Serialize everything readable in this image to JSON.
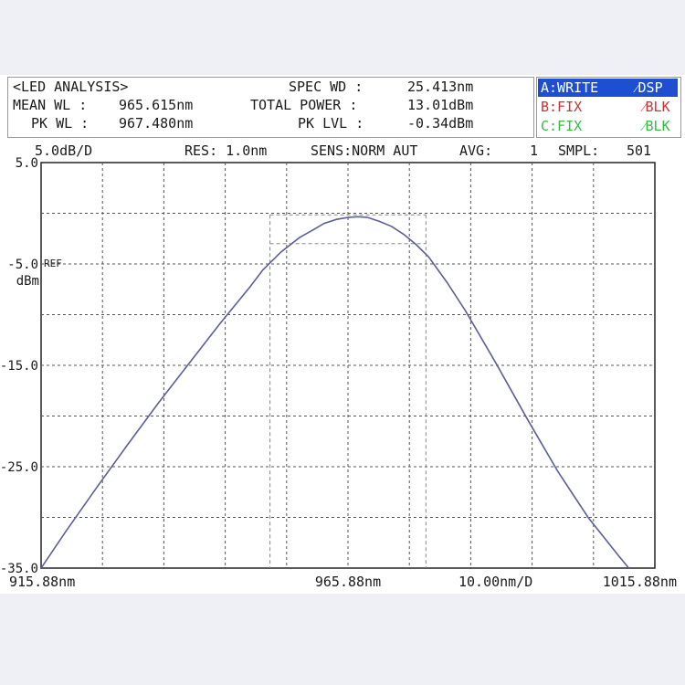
{
  "header": {
    "title": "<LED ANALYSIS>",
    "mean_wl_label": "MEAN WL :",
    "mean_wl_value": "965.615nm",
    "pk_wl_label": "PK WL :",
    "pk_wl_value": "967.480nm",
    "spec_wd_label": "SPEC WD :",
    "spec_wd_value": "25.413nm",
    "total_power_label": "TOTAL POWER :",
    "total_power_value": "13.01dBm",
    "pk_lvl_label": "PK LVL :",
    "pk_lvl_value": "-0.34dBm"
  },
  "traces": {
    "a_label": "A:WRITE",
    "a_mode": "⁄DSP",
    "b_label": "B:FIX",
    "b_mode": "⁄BLK",
    "c_label": "C:FIX",
    "c_mode": "⁄BLK"
  },
  "settings": {
    "scale": "5.0dB/D",
    "res": "RES: 1.0nm",
    "sens": "SENS:NORM AUT",
    "avg_label": "AVG:",
    "avg_value": "1",
    "smpl_label": "SMPL:",
    "smpl_value": "501"
  },
  "colors": {
    "trace": "#5a5f9a",
    "trace_a_bg": "#1f4fd1",
    "trace_b": "#cc3333",
    "trace_c": "#33bb44",
    "grid": "#555555",
    "marker": "#888888"
  },
  "chart_data": {
    "type": "line",
    "ytick_labels": [
      "5.0",
      "-5.0",
      "-15.0",
      "-25.0",
      "-35.0"
    ],
    "ref_label": "REF",
    "yunit": "dBm",
    "xtick_labels": [
      "915.88nm",
      "965.88nm",
      "10.00nm/D",
      "1015.88nm"
    ],
    "xlim": [
      915.88,
      1015.88
    ],
    "ylim": [
      -35,
      5
    ],
    "grid": true,
    "spec_width_markers": [
      953.17,
      978.58
    ],
    "spec_width_level": -3.0,
    "series": [
      {
        "x": [
          915.88,
          920,
          925,
          930,
          935,
          940,
          945,
          950,
          952,
          955,
          958,
          960,
          962,
          964,
          966,
          967.48,
          969,
          971,
          973,
          975,
          977,
          979,
          982,
          985,
          990,
          995,
          1000,
          1005,
          1010,
          1013
        ],
        "y": [
          -35.0,
          -31.3,
          -27.0,
          -22.8,
          -18.7,
          -14.8,
          -10.9,
          -7.2,
          -5.6,
          -3.8,
          -2.4,
          -1.7,
          -1.0,
          -0.6,
          -0.4,
          -0.34,
          -0.4,
          -0.8,
          -1.3,
          -2.1,
          -3.1,
          -4.3,
          -6.8,
          -9.6,
          -14.8,
          -20.2,
          -25.4,
          -30.0,
          -33.8,
          -36.0
        ]
      }
    ]
  }
}
